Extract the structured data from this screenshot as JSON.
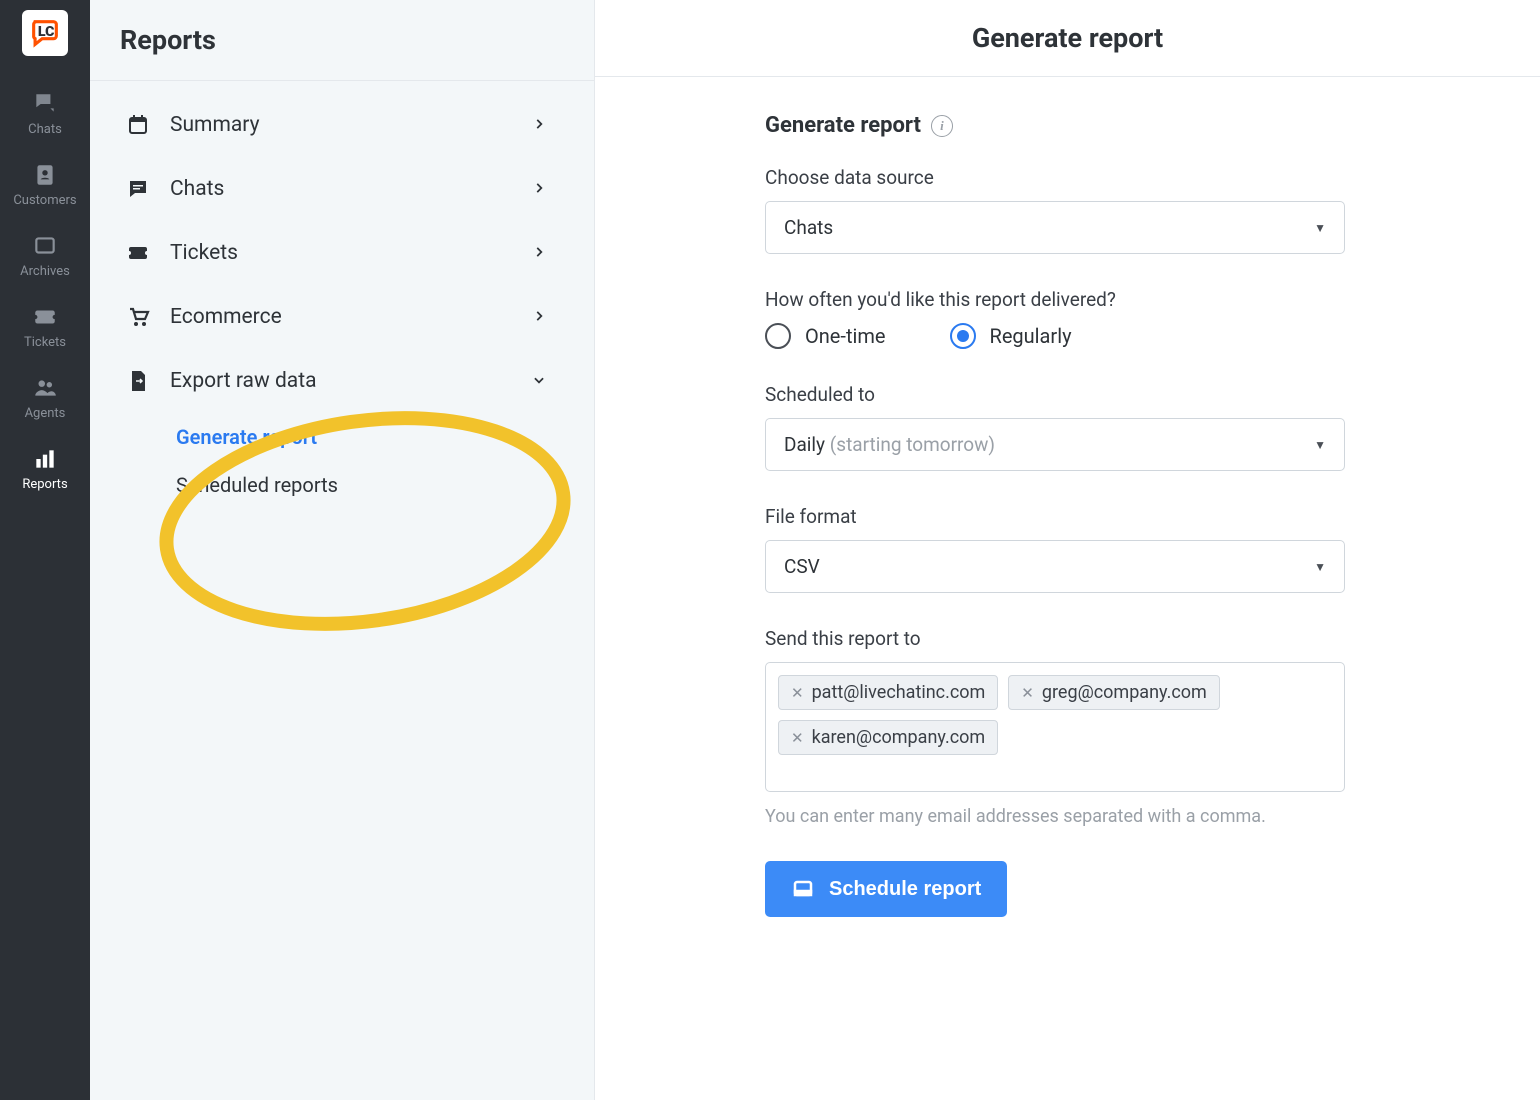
{
  "rail": {
    "items": [
      {
        "label": "Chats"
      },
      {
        "label": "Customers"
      },
      {
        "label": "Archives"
      },
      {
        "label": "Tickets"
      },
      {
        "label": "Agents"
      },
      {
        "label": "Reports"
      }
    ]
  },
  "sidebar": {
    "title": "Reports",
    "items": [
      {
        "label": "Summary"
      },
      {
        "label": "Chats"
      },
      {
        "label": "Tickets"
      },
      {
        "label": "Ecommerce"
      },
      {
        "label": "Export raw data"
      }
    ],
    "sub_items": [
      {
        "label": "Generate report"
      },
      {
        "label": "Scheduled reports"
      }
    ]
  },
  "main": {
    "header_title": "Generate report",
    "form_title": "Generate report",
    "data_source": {
      "label": "Choose data source",
      "value": "Chats"
    },
    "frequency": {
      "label": "How often you'd like this report delivered?",
      "options": {
        "one_time": "One-time",
        "regularly": "Regularly"
      },
      "selected": "regularly"
    },
    "scheduled": {
      "label": "Scheduled to",
      "value": "Daily",
      "hint": "(starting tomorrow)"
    },
    "file_format": {
      "label": "File format",
      "value": "CSV"
    },
    "recipients": {
      "label": "Send this report to",
      "emails": [
        "patt@livechatinc.com",
        "greg@company.com",
        "karen@company.com"
      ],
      "helper": "You can enter many email addresses separated with a comma."
    },
    "submit_label": "Schedule report"
  }
}
